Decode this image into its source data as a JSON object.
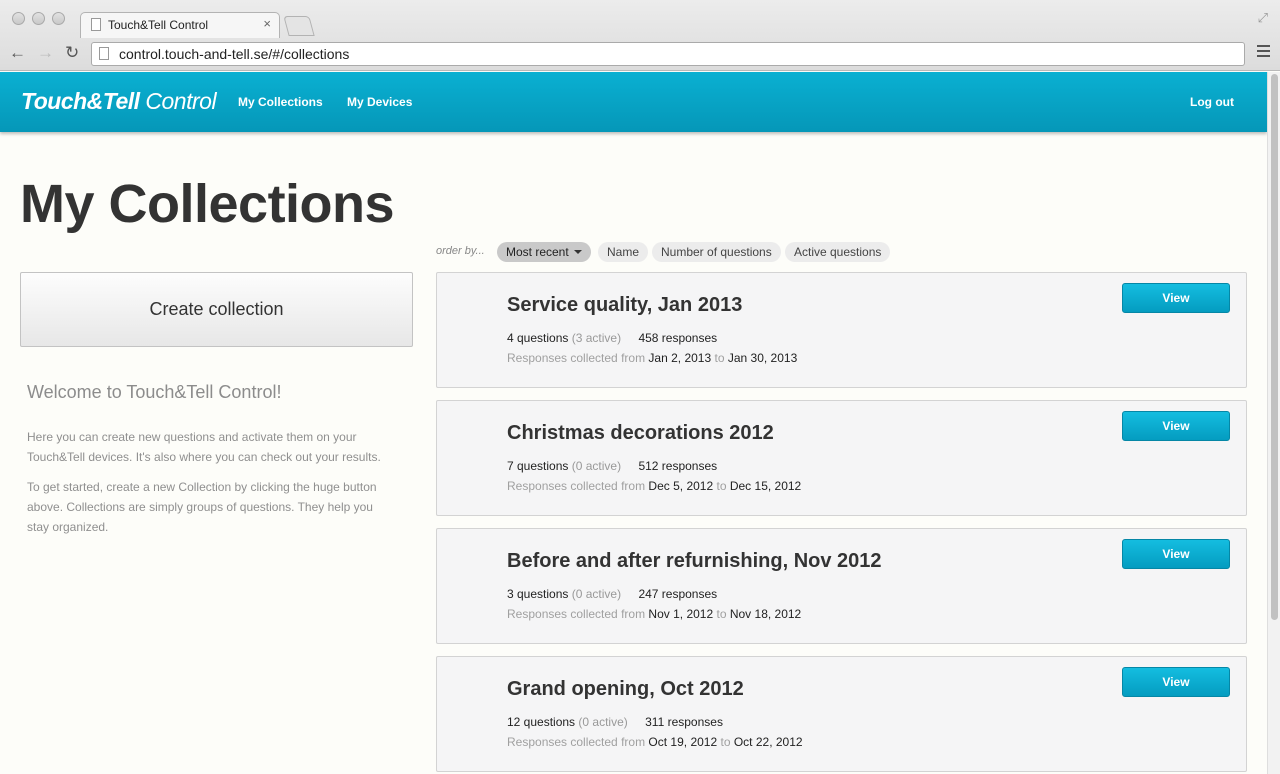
{
  "browser": {
    "tab_title": "Touch&Tell Control",
    "tab_close": "×",
    "url": "control.touch-and-tell.se/#/collections",
    "back_icon": "←",
    "forward_icon": "→",
    "reload_icon": "↻",
    "expand_icon": "⤢"
  },
  "header": {
    "brand_bold": "Touch&Tell",
    "brand_light": " Control",
    "nav": [
      "My Collections",
      "My Devices"
    ],
    "logout": "Log out",
    "color": "#0aa6c8"
  },
  "page": {
    "title": "My Collections",
    "create_button": "Create collection",
    "welcome_title": "Welcome to Touch&Tell Control!",
    "welcome_p1": "Here you can create new questions and activate them on your Touch&Tell devices. It's also where you can check out your results.",
    "welcome_p2": "To get started, create a new Collection by clicking the huge button above. Collections are simply groups of questions. They help you stay organized."
  },
  "order": {
    "label": "order by...",
    "options": [
      "Most recent",
      "Name",
      "Number of questions",
      "Active questions"
    ],
    "selected": "Most recent"
  },
  "collections": [
    {
      "title": "Service quality, Jan 2013",
      "questions": "4 questions",
      "active": "(3 active)",
      "responses": "458 responses",
      "range_label": "Responses collected from",
      "from": "Jan 2, 2013",
      "to_label": "to",
      "to": "Jan 30, 2013",
      "button": "View"
    },
    {
      "title": "Christmas decorations 2012",
      "questions": "7 questions",
      "active": "(0 active)",
      "responses": "512 responses",
      "range_label": "Responses collected from",
      "from": "Dec 5, 2012",
      "to_label": "to",
      "to": "Dec 15, 2012",
      "button": "View"
    },
    {
      "title": "Before and after refurnishing, Nov 2012",
      "questions": "3 questions",
      "active": "(0 active)",
      "responses": "247 responses",
      "range_label": "Responses collected from",
      "from": "Nov 1, 2012",
      "to_label": "to",
      "to": "Nov 18, 2012",
      "button": "View"
    },
    {
      "title": "Grand opening, Oct 2012",
      "questions": "12 questions",
      "active": "(0 active)",
      "responses": "311 responses",
      "range_label": "Responses collected from",
      "from": "Oct 19, 2012",
      "to_label": "to",
      "to": "Oct 22, 2012",
      "button": "View"
    }
  ]
}
